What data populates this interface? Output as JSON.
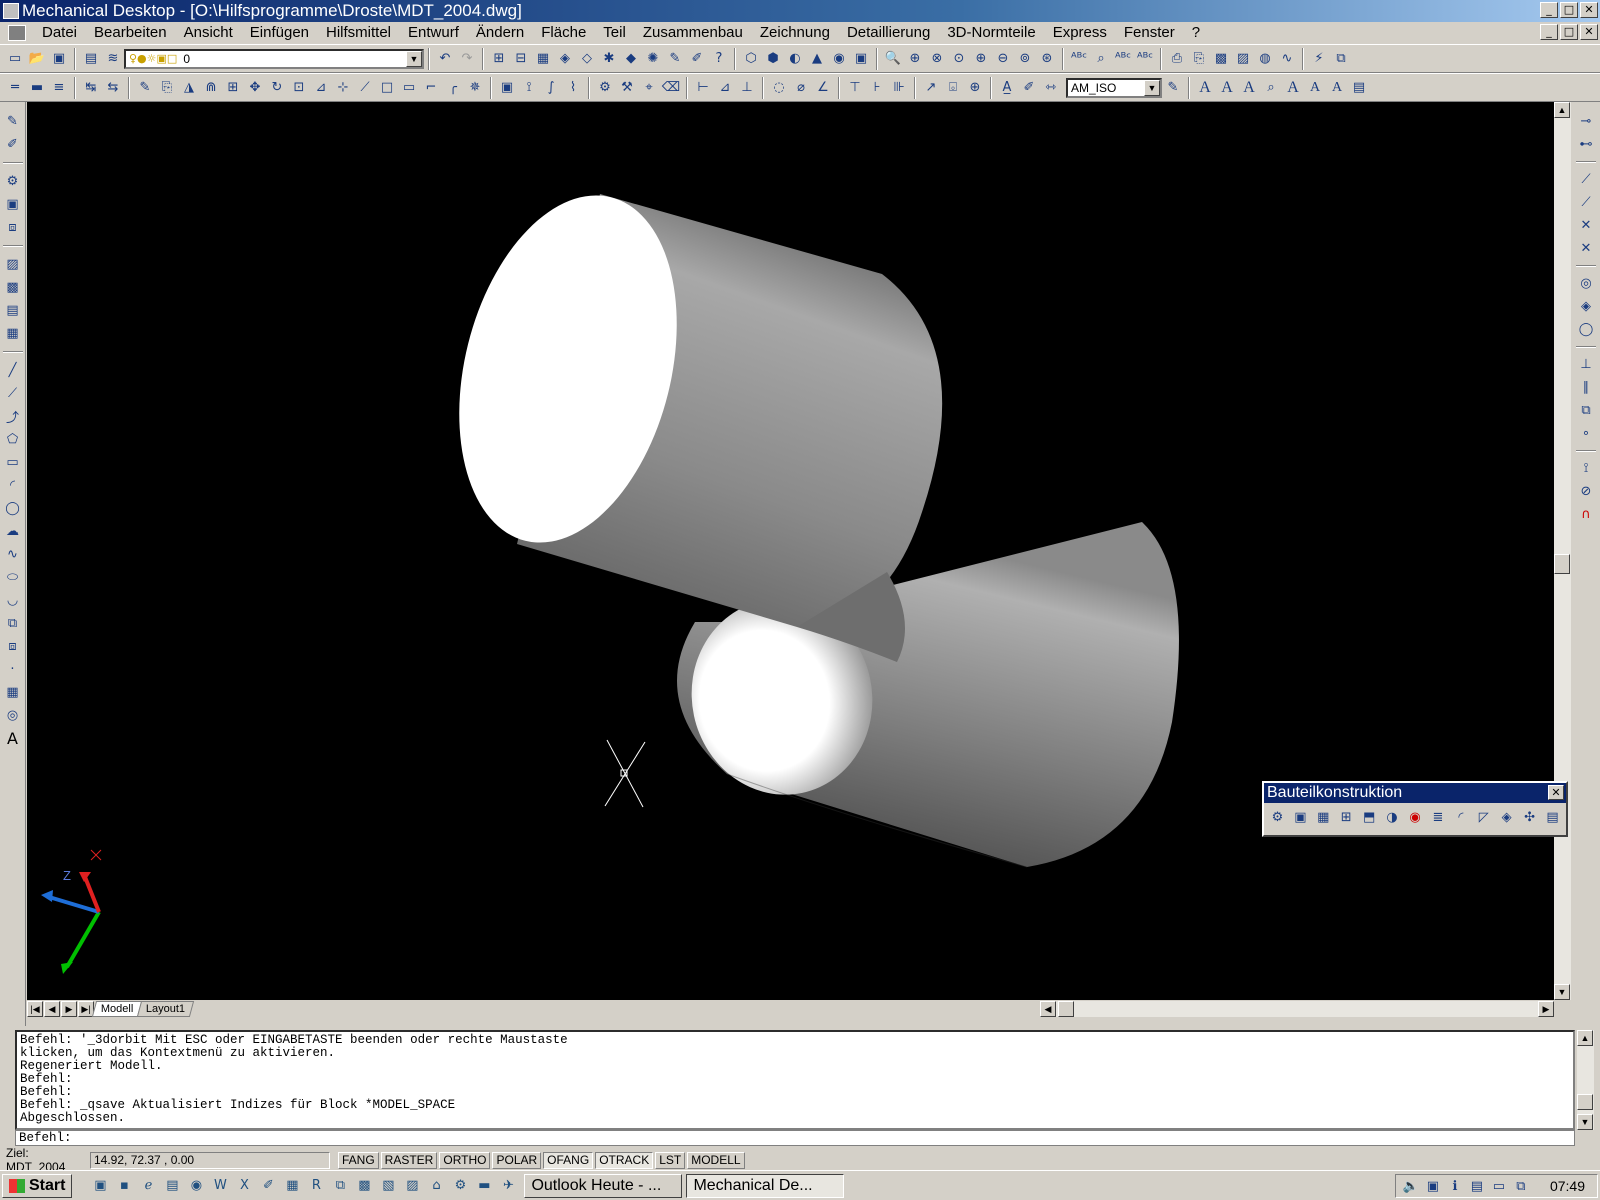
{
  "window": {
    "title": "Mechanical Desktop - [O:\\Hilfsprogramme\\Droste\\MDT_2004.dwg]",
    "btn_min": "_",
    "btn_max": "□",
    "btn_close": "✕"
  },
  "menu": {
    "items": [
      "Datei",
      "Bearbeiten",
      "Ansicht",
      "Einfügen",
      "Hilfsmittel",
      "Entwurf",
      "Ändern",
      "Fläche",
      "Teil",
      "Zusammenbau",
      "Zeichnung",
      "Detaillierung",
      "3D-Normteile",
      "Express",
      "Fenster",
      "?"
    ]
  },
  "toolbar": {
    "layer_value": "0",
    "dimstyle_value": "AM_ISO"
  },
  "viewport": {
    "background": "#000000",
    "ucs_z_label": "Z"
  },
  "layout_tabs": [
    "Modell",
    "Layout1"
  ],
  "floating_toolbar": {
    "title": "Bauteilkonstruktion"
  },
  "command": {
    "history": [
      "Befehl: '_3dorbit Mit ESC oder EINGABETASTE beenden oder rechte Maustaste",
      "klicken, um das Kontextmenü zu aktivieren.",
      "Regeneriert Modell.",
      "Befehl:",
      "Befehl:",
      "Befehl: _qsave Aktualisiert Indizes für Block *MODEL_SPACE",
      "Abgeschlossen."
    ],
    "prompt": "Befehl:"
  },
  "status": {
    "label": "Ziel: MDT_2004",
    "coords": "14.92,  72.37 , 0.00",
    "modes": [
      {
        "label": "FANG",
        "on": false
      },
      {
        "label": "RASTER",
        "on": false
      },
      {
        "label": "ORTHO",
        "on": false
      },
      {
        "label": "POLAR",
        "on": false
      },
      {
        "label": "OFANG",
        "on": true
      },
      {
        "label": "OTRACK",
        "on": true
      },
      {
        "label": "LST",
        "on": false
      },
      {
        "label": "MODELL",
        "on": false
      }
    ]
  },
  "taskbar": {
    "start_label": "Start",
    "tasks": [
      {
        "label": "Outlook Heute - ...",
        "active": false
      },
      {
        "label": "Mechanical De...",
        "active": true
      }
    ],
    "clock": "07:49"
  }
}
